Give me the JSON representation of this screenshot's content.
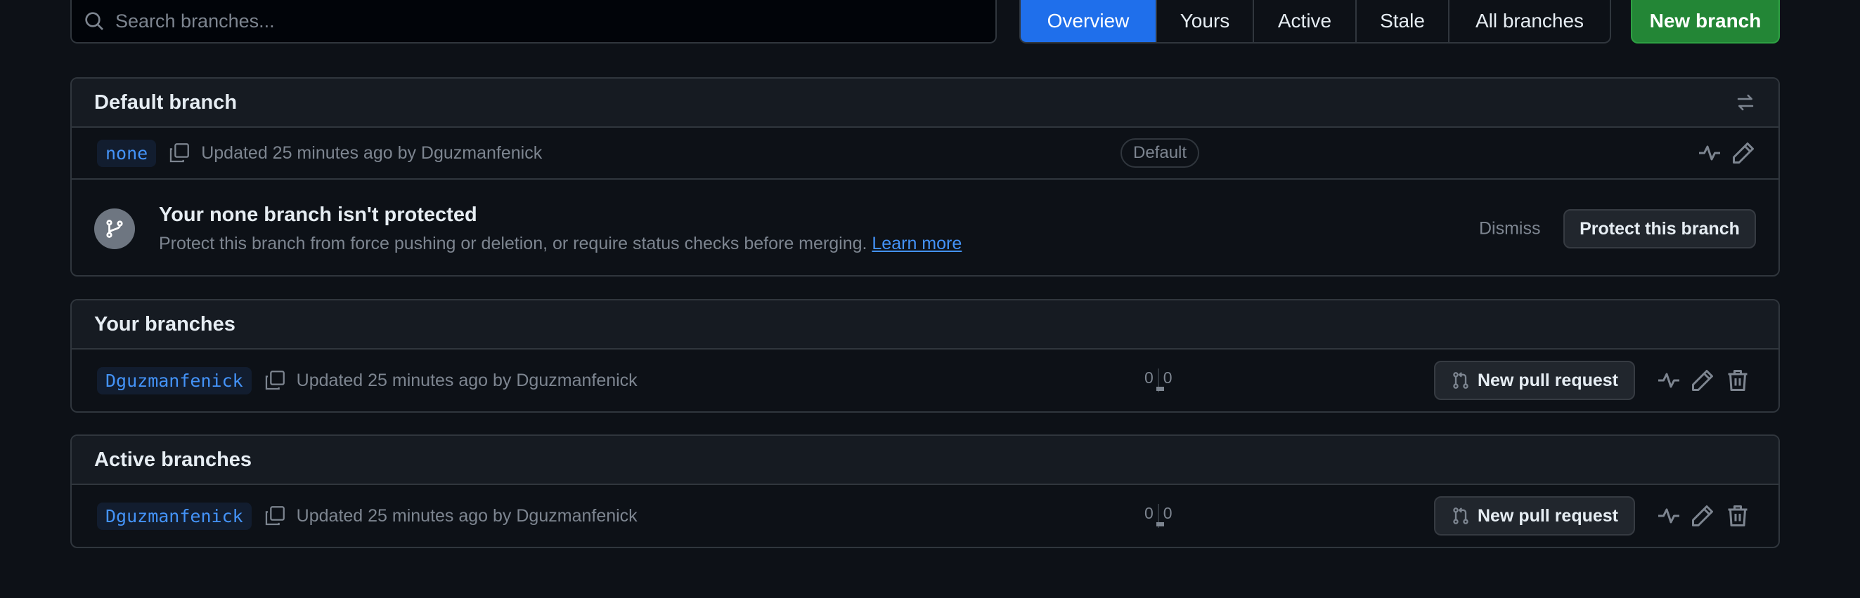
{
  "search": {
    "placeholder": "Search branches..."
  },
  "tabs": [
    {
      "label": "Overview",
      "active": true
    },
    {
      "label": "Yours",
      "active": false
    },
    {
      "label": "Active",
      "active": false
    },
    {
      "label": "Stale",
      "active": false
    },
    {
      "label": "All branches",
      "active": false
    }
  ],
  "new_branch_label": "New branch",
  "default_branch": {
    "title": "Default branch",
    "branch_name": "none",
    "updated": "Updated 25 minutes ago by Dguzmanfenick",
    "badge": "Default",
    "protection": {
      "title": "Your none branch isn't protected",
      "description": "Protect this branch from force pushing or deletion, or require status checks before merging.",
      "link": "Learn more",
      "dismiss": "Dismiss",
      "protect_button": "Protect this branch"
    }
  },
  "your_branches": {
    "title": "Your branches",
    "rows": [
      {
        "branch_name": "Dguzmanfenick",
        "updated": "Updated 25 minutes ago by Dguzmanfenick",
        "behind": "0",
        "ahead": "0",
        "pr_button": "New pull request"
      }
    ]
  },
  "active_branches": {
    "title": "Active branches",
    "rows": [
      {
        "branch_name": "Dguzmanfenick",
        "updated": "Updated 25 minutes ago by Dguzmanfenick",
        "behind": "0",
        "ahead": "0",
        "pr_button": "New pull request"
      }
    ]
  },
  "colors": {
    "background": "#0d1117",
    "accent": "#1f6feb",
    "primary_button": "#238636",
    "link": "#4493f8"
  },
  "icons": [
    "search-icon",
    "switch-arrows-icon",
    "copy-icon",
    "activity-icon",
    "pencil-icon",
    "git-branch-icon",
    "git-pull-request-icon",
    "trash-icon"
  ]
}
